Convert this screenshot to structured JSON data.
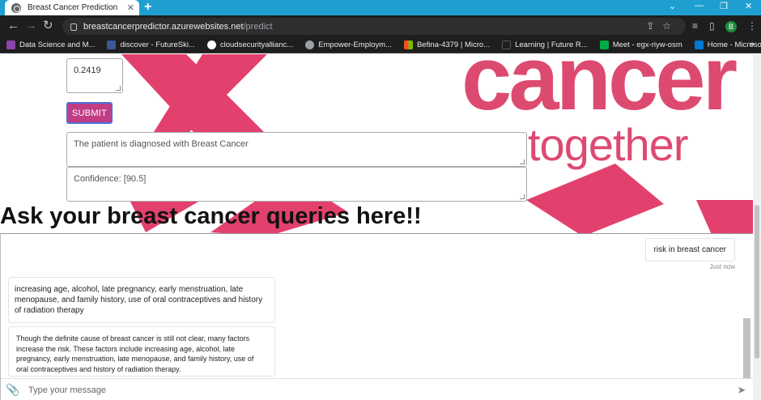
{
  "browser": {
    "tab_title": "Breast Cancer Prediction",
    "url_host": "breastcancerpredictor.azurewebsites.net",
    "url_path": "/predict",
    "profile_initial": "B"
  },
  "bookmarks": [
    {
      "label": "Data Science and M...",
      "color": "#8e44ad"
    },
    {
      "label": "discover - FutureSki...",
      "color": "#3b5998"
    },
    {
      "label": "cloudsecurityallianc...",
      "color": "#ffffff"
    },
    {
      "label": "Empower-Employm...",
      "color": "#9aa0a6"
    },
    {
      "label": "Befina-4379 | Micro...",
      "color": "#f25022"
    },
    {
      "label": "Learning | Future R...",
      "color": "#1e1e1e"
    },
    {
      "label": "Meet - egx-riyw-osm",
      "color": "#00ac47"
    },
    {
      "label": "Home - Microsoft A...",
      "color": "#0078d4"
    }
  ],
  "banner": {
    "word1": "cancer",
    "word2": "together",
    "color": "#dd4a70"
  },
  "form": {
    "last_field_value": "0.2419",
    "submit_label": "SUBMIT",
    "diagnosis": "The patient is diagnosed with Breast Cancer",
    "confidence": "Confidence: [90.5]"
  },
  "chat": {
    "heading": "Ask your breast cancer queries here!!",
    "user_message": "risk in breast cancer",
    "timestamp": "Just now",
    "bot_reply_1": "increasing age, alcohol, late pregnancy, early menstruation, late menopause, and family history, use of oral contraceptives and history of radiation therapy",
    "bot_reply_2": "Though the definite cause of breast cancer is still not clear, many factors increase the risk. These factors include increasing age, alcohol, late pregnancy, early menstruation, late menopause, and family history, use of oral contraceptives and history of radiation therapy.",
    "input_placeholder": "Type your message"
  }
}
